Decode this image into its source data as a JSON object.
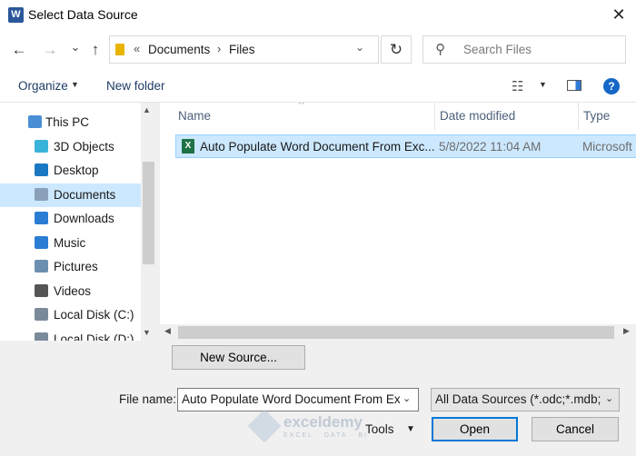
{
  "window": {
    "title": "Select Data Source",
    "app_icon": "W",
    "close_glyph": "✕"
  },
  "nav": {
    "back_glyph": "←",
    "forward_glyph": "→",
    "recent_glyph": "⌄",
    "up_glyph": "↑",
    "address": {
      "more": "«",
      "crumbs": [
        "Documents",
        "Files"
      ],
      "separator": "›",
      "dropdown_glyph": "⌄"
    },
    "refresh_glyph": "↻",
    "search": {
      "placeholder": "Search Files",
      "icon_glyph": "⚲"
    }
  },
  "toolbar": {
    "organize_label": "Organize",
    "caret": "▼",
    "new_folder_label": "New folder",
    "view_glyph": "☷",
    "help_glyph": "?"
  },
  "sidebar": {
    "items": [
      {
        "label": "This PC",
        "icon": "computer-icon",
        "color": "#4a8fd6"
      },
      {
        "label": "3D Objects",
        "icon": "cube-icon",
        "color": "#3ab3d9"
      },
      {
        "label": "Desktop",
        "icon": "desktop-icon",
        "color": "#1a78c2"
      },
      {
        "label": "Documents",
        "icon": "document-icon",
        "color": "#8aa0b8"
      },
      {
        "label": "Downloads",
        "icon": "download-icon",
        "color": "#2b7cd3"
      },
      {
        "label": "Music",
        "icon": "music-icon",
        "color": "#2b7cd3"
      },
      {
        "label": "Pictures",
        "icon": "picture-icon",
        "color": "#6c8fb0"
      },
      {
        "label": "Videos",
        "icon": "video-icon",
        "color": "#555555"
      },
      {
        "label": "Local Disk (C:)",
        "icon": "disk-icon",
        "color": "#7a8a9a"
      },
      {
        "label": "Local Disk (D:)",
        "icon": "disk-icon",
        "color": "#7a8a9a"
      }
    ],
    "selected": "Documents",
    "scroll_up": "▲",
    "scroll_down": "▼"
  },
  "filelist": {
    "columns": [
      "Name",
      "Date modified",
      "Type"
    ],
    "sort_glyph": "^",
    "rows": [
      {
        "name": "Auto Populate Word Document From Exc...",
        "date": "5/8/2022 11:04 AM",
        "type": "Microsoft",
        "icon": "excel-file-icon",
        "icon_glyph": "X"
      }
    ],
    "scroll_left": "◀",
    "scroll_right": "▶"
  },
  "footer": {
    "new_source_label": "New Source...",
    "file_name_label": "File name:",
    "file_name_value": "Auto Populate Word Document From Exc",
    "file_type_value": "All Data Sources (*.odc;*.mdb;*.",
    "dropdown_glyph": "⌄",
    "tools_label": "Tools",
    "tools_caret": "▼",
    "open_label": "Open",
    "cancel_label": "Cancel"
  },
  "watermark": {
    "name": "exceldemy",
    "tagline": "EXCEL · DATA · BI"
  },
  "colors": {
    "accent": "#0078d7",
    "selection": "#cce8ff",
    "link": "#1f3c66"
  }
}
